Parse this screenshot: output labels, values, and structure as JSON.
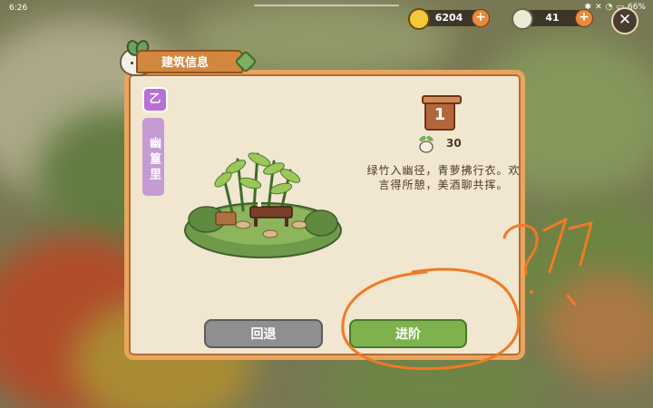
{
  "status_bar": {
    "time": "6:26",
    "battery": "66%"
  },
  "currencies": [
    {
      "value": "6204",
      "icon": "gold-coin-icon",
      "color": "#e8c23a"
    },
    {
      "value": "41",
      "icon": "jade-coin-icon",
      "color": "#7cbf6a"
    }
  ],
  "dialog": {
    "title": "建筑信息",
    "tier": "乙",
    "building_name": "幽篁里",
    "level": "1",
    "cost": "30",
    "description": "绿竹入幽径，青萝拂行衣。欢言得所憩，美酒聊共挥。",
    "back_label": "回退",
    "advance_label": "进阶"
  },
  "colors": {
    "accent": "#e7a560",
    "advance": "#7eb24e",
    "back": "#8f8f8f",
    "annotation": "#f07a24"
  }
}
